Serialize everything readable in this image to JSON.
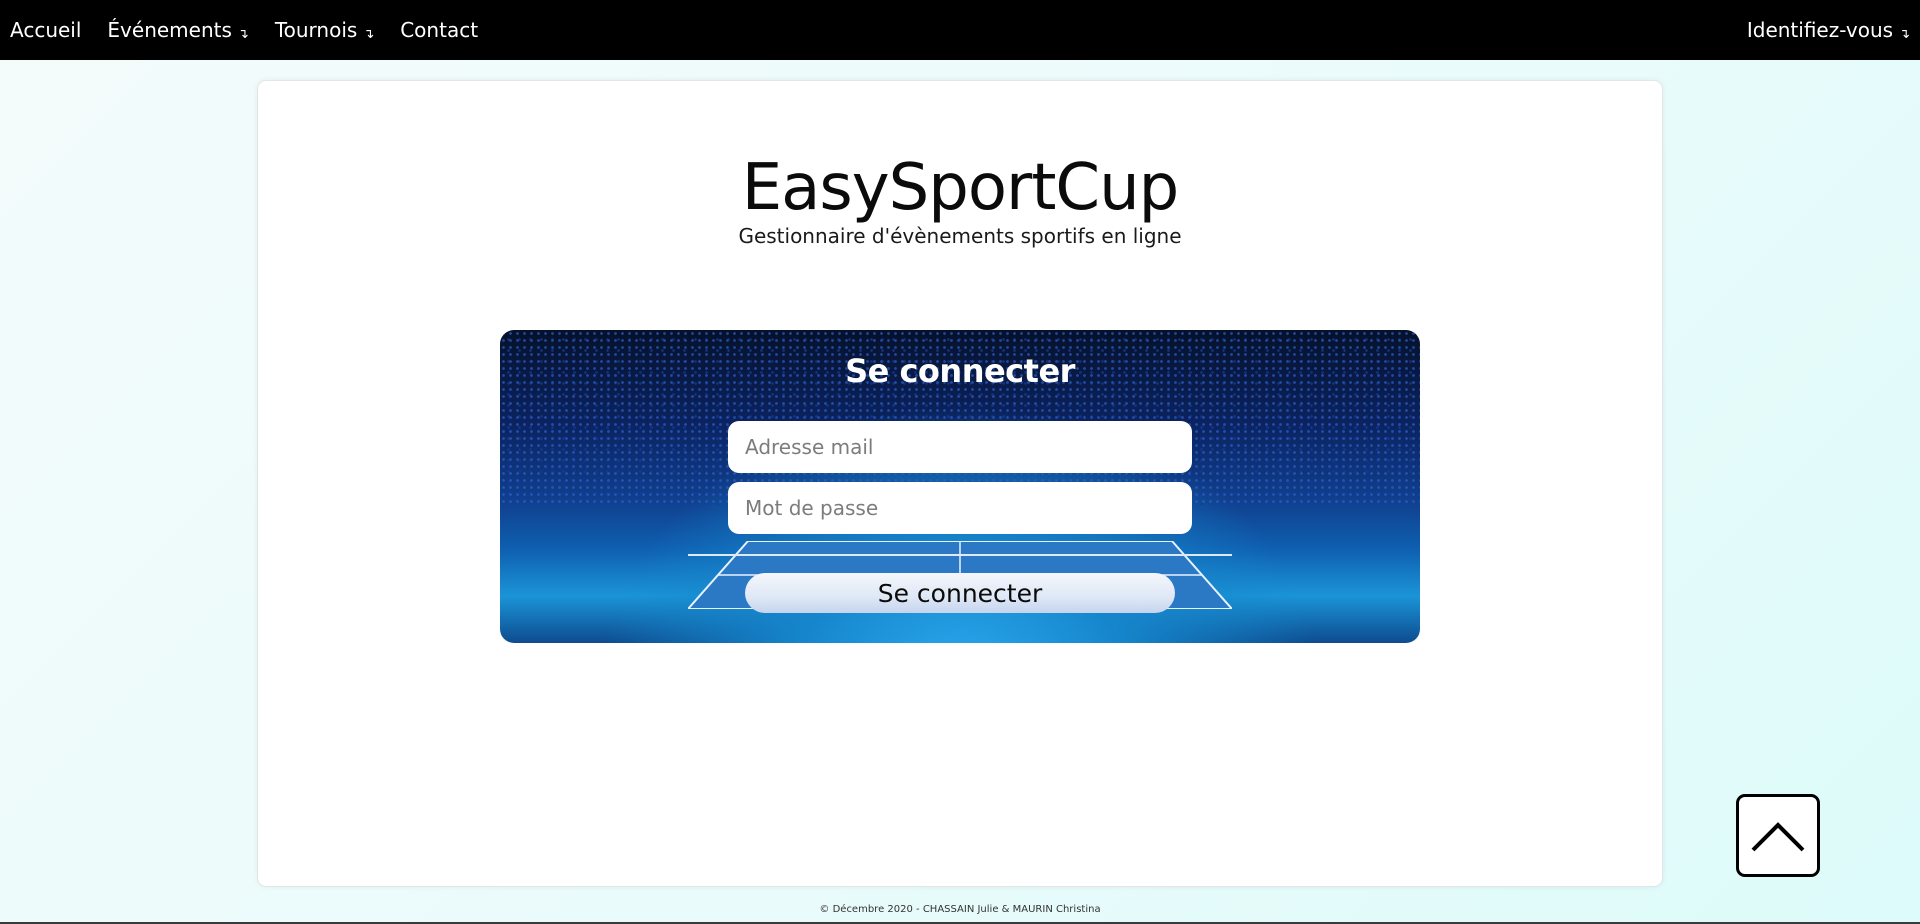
{
  "nav": {
    "items": [
      {
        "label": "Accueil",
        "dropdown": false
      },
      {
        "label": "Événements",
        "dropdown": true
      },
      {
        "label": "Tournois",
        "dropdown": true
      },
      {
        "label": "Contact",
        "dropdown": false
      }
    ],
    "account_label": "Identifiez-vous",
    "dropdown_glyph": "↴"
  },
  "brand": {
    "title": "EasySportCup",
    "subtitle": "Gestionnaire d'évènements sportifs en ligne"
  },
  "login": {
    "title": "Se connecter",
    "email_placeholder": "Adresse mail",
    "password_placeholder": "Mot de passe",
    "submit_label": "Se connecter"
  },
  "footer": {
    "text": "© Décembre 2020 - CHASSAIN Julie & MAURIN Christina"
  },
  "icons": {
    "scroll_top": "chevron-up-icon"
  },
  "colors": {
    "nav_bg": "#000000",
    "nav_text": "#ffffff",
    "page_bg": "#e9fbfb"
  }
}
